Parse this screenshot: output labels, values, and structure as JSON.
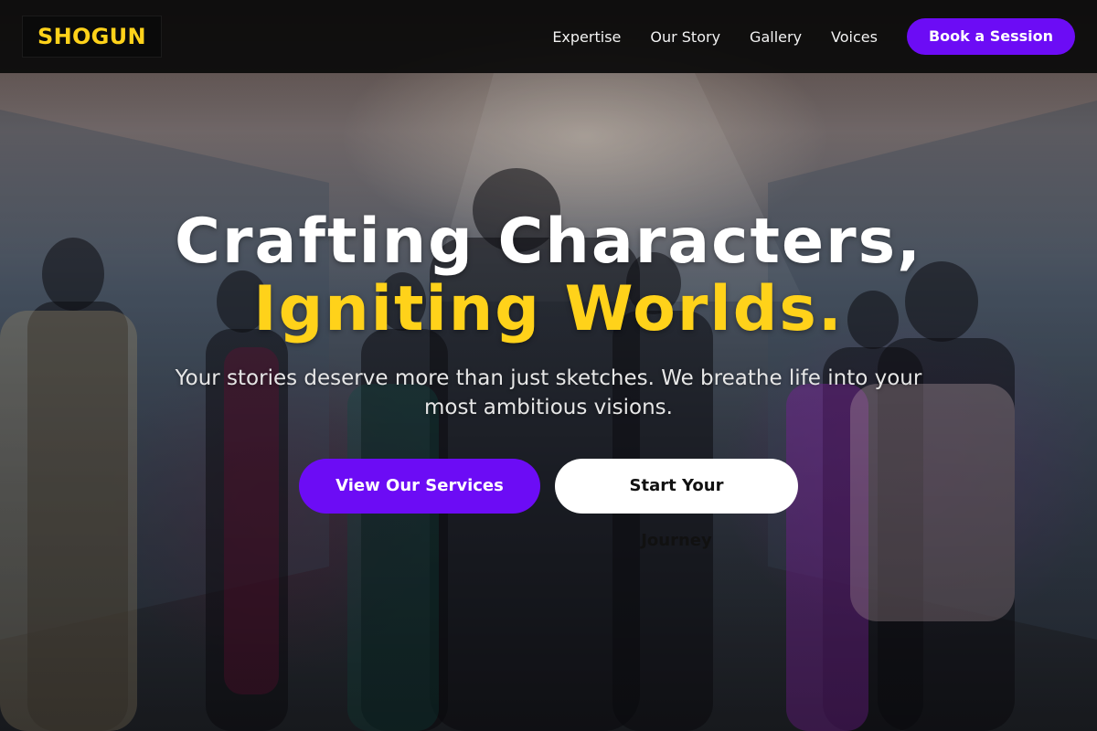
{
  "nav": {
    "logo": "SHOGUN",
    "links": [
      "Expertise",
      "Our Story",
      "Gallery",
      "Voices"
    ],
    "cta": "Book a Session"
  },
  "hero": {
    "headline_line1": "Crafting Characters,",
    "headline_line2": "Igniting Worlds.",
    "subtext": "Your stories deserve more than just sketches. We breathe life into your most ambitious visions.",
    "primary_button": "View Our Services",
    "secondary_button": "Start Your Journey",
    "background_image": "group of costumed performers on a stage"
  },
  "colors": {
    "brand_yellow": "#ffd21a",
    "accent_purple": "#6c0cf5",
    "nav_bg": "#0a0a0a"
  }
}
